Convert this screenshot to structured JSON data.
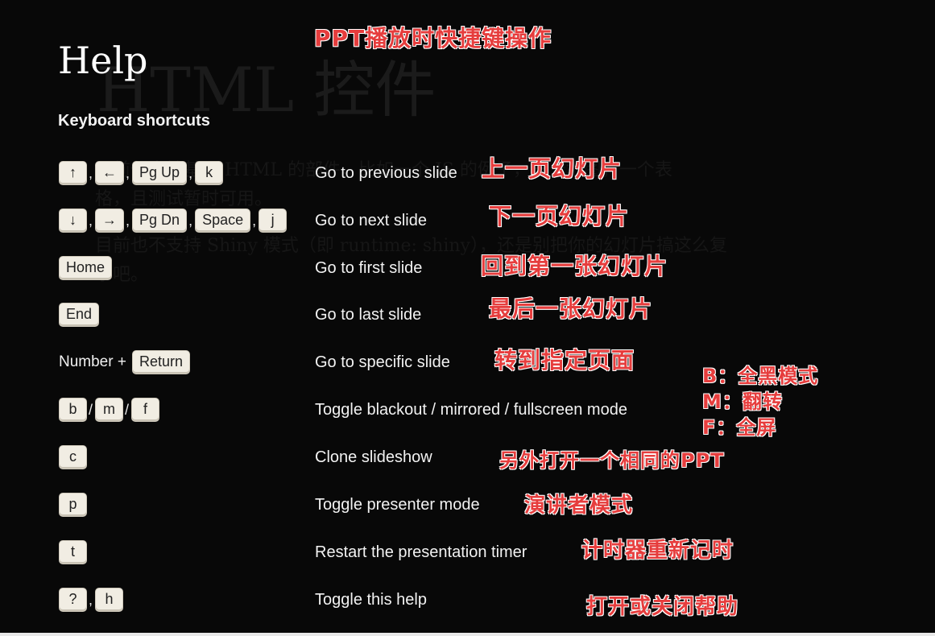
{
  "background_slide": {
    "title": "HTML 控件",
    "paragraph_1_line_1": "目前仅支持基于 HTML 的部件，比如一个 JS 的例子，一个地图，一个表",
    "paragraph_1_line_2": "格，且测试暂时可用。",
    "paragraph_2_line_1": "目前也不支持 Shiny 模式（即 runtime: shiny），还是别把你的幻灯片搞这么复",
    "paragraph_2_line_2": "杂吧。"
  },
  "help": {
    "title": "Help",
    "subtitle": "Keyboard shortcuts",
    "shortcuts": [
      {
        "keys": [
          "↑",
          "←",
          "Pg Up",
          "k"
        ],
        "separator": ",",
        "description": "Go to previous slide",
        "annotation": "上一页幻灯片"
      },
      {
        "keys": [
          "↓",
          "→",
          "Pg Dn",
          "Space",
          "j"
        ],
        "separator": ",",
        "description": "Go to next slide",
        "annotation": "下一页幻灯片"
      },
      {
        "keys": [
          "Home"
        ],
        "description": "Go to first slide",
        "annotation": "回到第一张幻灯片"
      },
      {
        "keys": [
          "End"
        ],
        "description": "Go to last slide",
        "annotation": "最后一张幻灯片"
      },
      {
        "prefix": "Number +",
        "keys": [
          "Return"
        ],
        "description": "Go to specific slide",
        "annotation": "转到指定页面"
      },
      {
        "keys": [
          "b",
          "m",
          "f"
        ],
        "separator": "/",
        "description": "Toggle blackout / mirrored / fullscreen mode",
        "annotation_lines": [
          "B：全黑模式",
          "M：翻转",
          "F：全屏"
        ]
      },
      {
        "keys": [
          "c"
        ],
        "description": "Clone slideshow",
        "annotation": "另外打开一个相同的PPT"
      },
      {
        "keys": [
          "p"
        ],
        "description": "Toggle presenter mode",
        "annotation": "演讲者模式"
      },
      {
        "keys": [
          "t"
        ],
        "description": "Restart the presentation timer",
        "annotation": "计时器重新记时"
      },
      {
        "keys": [
          "?",
          "h"
        ],
        "separator": ",",
        "description": "Toggle this help",
        "annotation": "打开或关闭帮助"
      }
    ]
  },
  "header_annotation": "PPT播放时快捷键操作",
  "colors": {
    "background": "#080808",
    "annotation_red": "#e63d3d",
    "key_cap": "#f1ede3"
  }
}
